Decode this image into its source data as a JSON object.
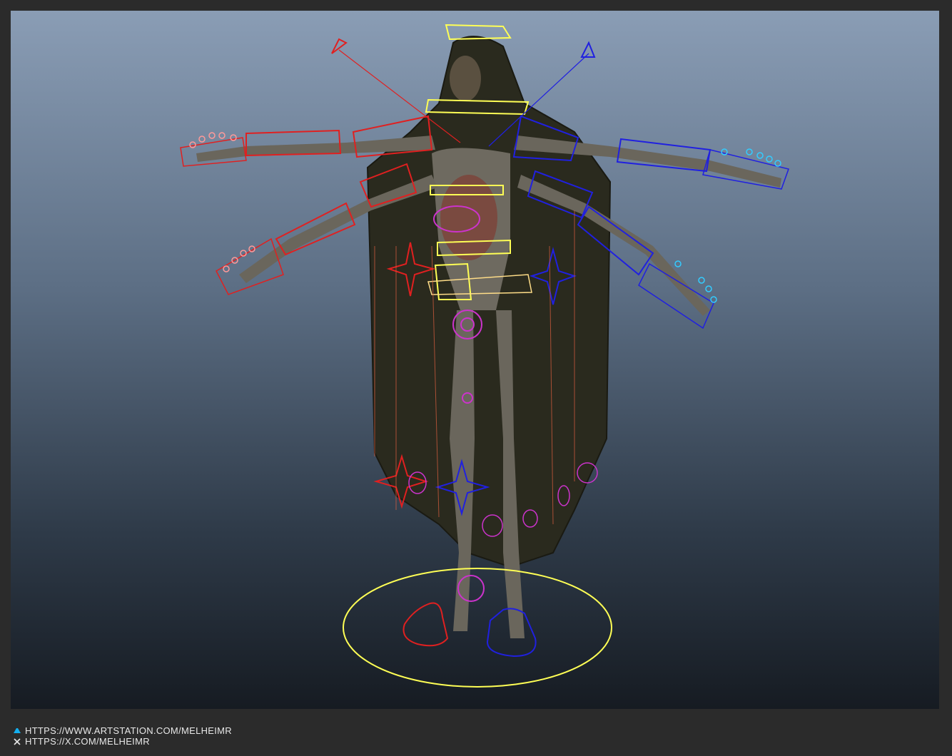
{
  "viewport": {
    "scene": "rigged-character"
  },
  "footer": {
    "links": [
      {
        "icon": "artstation-icon",
        "text": "HTTPS://WWW.ARTSTATION.COM/MELHEIMR"
      },
      {
        "icon": "x-icon",
        "text": "HTTPS://X.COM/MELHEIMR"
      }
    ]
  },
  "colors": {
    "frame": "#2b2b2b",
    "left_controls": "#e02020",
    "right_controls": "#2020e0",
    "center_controls": "#ffff55",
    "ik_controls": "#cc33cc",
    "left_fingers": "#ff9999",
    "right_fingers": "#33ccff"
  }
}
